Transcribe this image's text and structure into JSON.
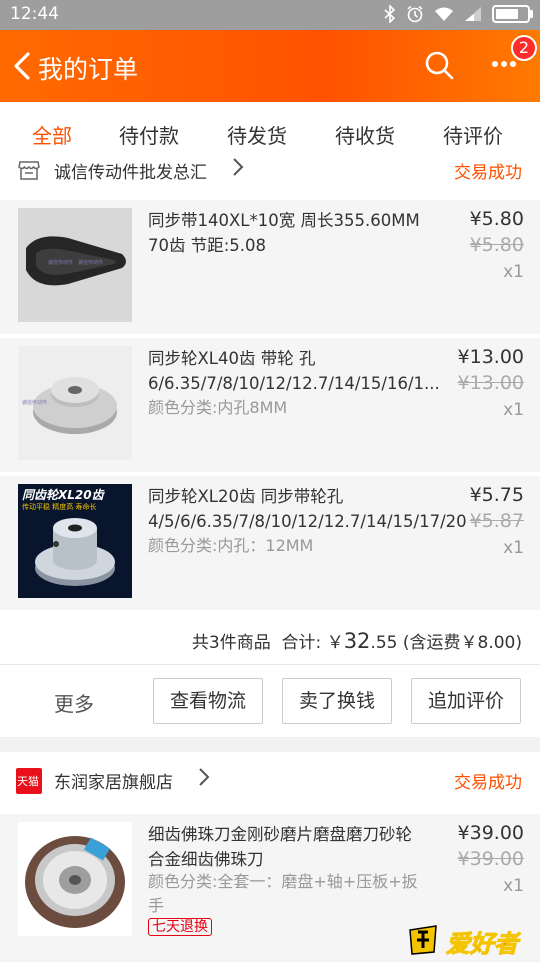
{
  "status_bar": {
    "time": "12:44"
  },
  "header": {
    "title": "我的订单",
    "badge_count": "2"
  },
  "tabs": [
    "全部",
    "待付款",
    "待发货",
    "待收货",
    "待评价"
  ],
  "orders": [
    {
      "shop": "诚信传动件批发总汇",
      "status": "交易成功",
      "items": [
        {
          "name": "同步带140XL*10宽 周长355.60MM 70齿 节距:5.08",
          "variant": "",
          "price": "¥5.80",
          "orig_price": "¥5.80",
          "qty": "x1"
        },
        {
          "name": "同步轮XL40齿 带轮 孔6/6.35/7/8/10/12/12.7/14/15/16/1...",
          "variant": "颜色分类:内孔8MM",
          "price": "¥13.00",
          "orig_price": "¥13.00",
          "qty": "x1"
        },
        {
          "name": "同步轮XL20齿 同步带轮孔4/5/6/6.35/7/8/10/12/12.7/14/15/17/20",
          "variant": "颜色分类:内孔：12MM",
          "price": "¥5.75",
          "orig_price": "¥5.87",
          "qty": "x1",
          "thumb_label": "同齿轮XL20齿",
          "thumb_sub": "传动平稳 精度高 寿命长"
        }
      ],
      "summary": {
        "count_text": "共3件商品",
        "total_label": "合计:",
        "currency": "￥",
        "amount": "32",
        "decimals": ".55",
        "shipping": "(含运费￥8.00)"
      },
      "more_label": "更多",
      "buttons": [
        "查看物流",
        "卖了换钱",
        "追加评价"
      ]
    },
    {
      "shop": "东润家居旗舰店",
      "shop_logo_text": "天猫",
      "status": "交易成功",
      "items": [
        {
          "name": "细齿佛珠刀金刚砂磨片磨盘磨刀砂轮合金细齿佛珠刀",
          "variant": "颜色分类:全套一：磨盘+轴+压板+扳手",
          "price": "¥39.00",
          "orig_price": "¥39.00",
          "qty": "x1",
          "tag": "七天退换"
        }
      ]
    }
  ],
  "watermark": "爱好者",
  "colors": {
    "accent": "#ff5000",
    "header": "#ff6a00",
    "badge": "#ff2a2a"
  }
}
